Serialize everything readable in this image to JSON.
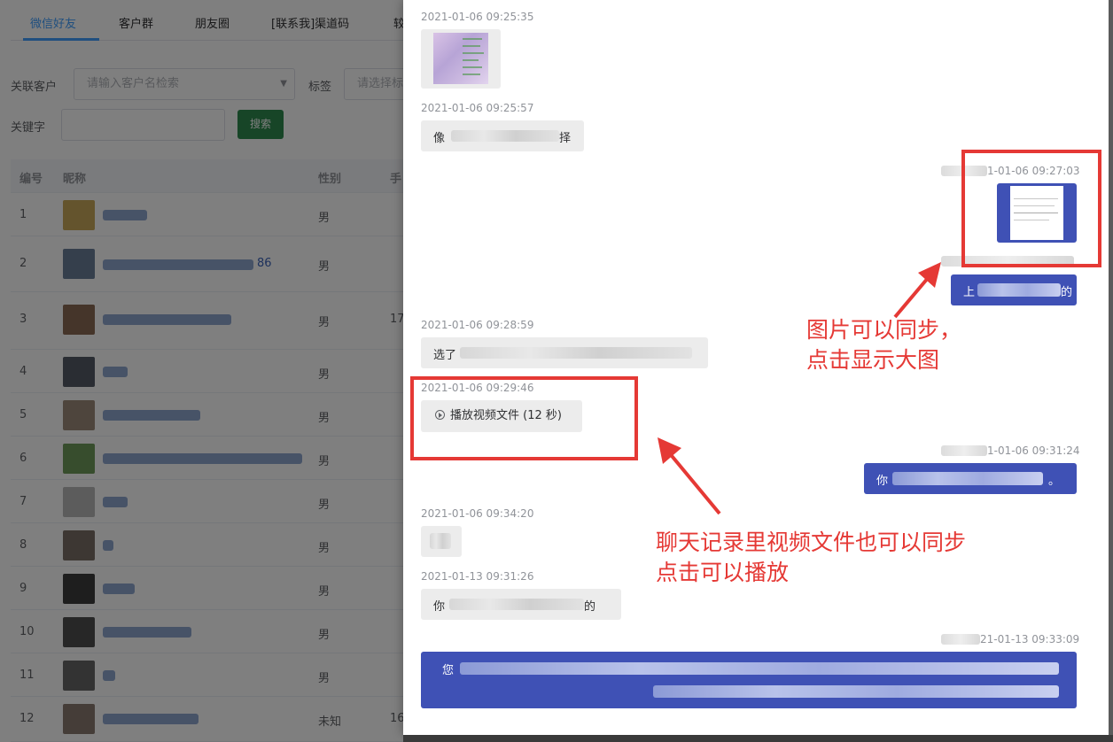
{
  "tabs": [
    "微信好友",
    "客户群",
    "朋友圈",
    "[联系我]渠道码",
    "较"
  ],
  "filters": {
    "customer_label": "关联客户",
    "customer_placeholder": "请输入客户名检索",
    "tag_label": "标签",
    "tag_placeholder": "请选择标签",
    "keyword_label": "关键字",
    "search_button": "搜索"
  },
  "table": {
    "headers": [
      "编号",
      "昵称",
      "性别",
      "手"
    ],
    "rows": [
      {
        "id": "1",
        "name": "",
        "gender": "男",
        "phone": ""
      },
      {
        "id": "2",
        "name": "86",
        "gender": "男",
        "phone": ""
      },
      {
        "id": "3",
        "name": "",
        "gender": "男",
        "phone": "17"
      },
      {
        "id": "4",
        "name": "",
        "gender": "男",
        "phone": ""
      },
      {
        "id": "5",
        "name": "",
        "gender": "男",
        "phone": ""
      },
      {
        "id": "6",
        "name": "",
        "gender": "男",
        "phone": ""
      },
      {
        "id": "7",
        "name": "",
        "gender": "男",
        "phone": ""
      },
      {
        "id": "8",
        "name": "",
        "gender": "男",
        "phone": ""
      },
      {
        "id": "9",
        "name": "",
        "gender": "男",
        "phone": ""
      },
      {
        "id": "10",
        "name": "",
        "gender": "男",
        "phone": ""
      },
      {
        "id": "11",
        "name": "",
        "gender": "男",
        "phone": ""
      },
      {
        "id": "12",
        "name": "",
        "gender": "未知",
        "phone": "16"
      }
    ]
  },
  "chat": {
    "messages": [
      {
        "direction": "in",
        "time": "2021-01-06 09:25:35",
        "type": "image"
      },
      {
        "direction": "in",
        "time": "2021-01-06 09:25:57",
        "type": "text",
        "text_start": "像",
        "text_end": "择"
      },
      {
        "direction": "out",
        "time": "1-01-06 09:27:03",
        "type": "image"
      },
      {
        "direction": "out",
        "time": "",
        "type": "text",
        "text_start": "上",
        "text_end": "的"
      },
      {
        "direction": "in",
        "time": "2021-01-06 09:28:59",
        "type": "text",
        "text_start": "选了",
        "text_end": ""
      },
      {
        "direction": "in",
        "time": "2021-01-06 09:29:46",
        "type": "video",
        "label": "播放视频文件 (12 秒)"
      },
      {
        "direction": "out",
        "time": "1-01-06 09:31:24",
        "type": "text",
        "text_start": "你",
        "text_end": "。"
      },
      {
        "direction": "in",
        "time": "2021-01-06 09:34:20",
        "type": "text",
        "text_start": "",
        "text_end": ""
      },
      {
        "direction": "in",
        "time": "2021-01-13 09:31:26",
        "type": "text",
        "text_start": "你",
        "text_end": "的"
      },
      {
        "direction": "out",
        "time": "21-01-13 09:33:09",
        "type": "text",
        "text_start": "您",
        "text_end": ""
      }
    ]
  },
  "annotations": {
    "image_note_line1": "图片可以同步，",
    "image_note_line2": "点击显示大图",
    "video_note_line1": "聊天记录里视频文件也可以同步",
    "video_note_line2": "点击可以播放",
    "color": "#e53935"
  },
  "colors": {
    "accent": "#409eff",
    "search_button": "#2f8a4e",
    "outgoing_bubble": "#3f51b5",
    "incoming_bubble": "#ececec"
  }
}
